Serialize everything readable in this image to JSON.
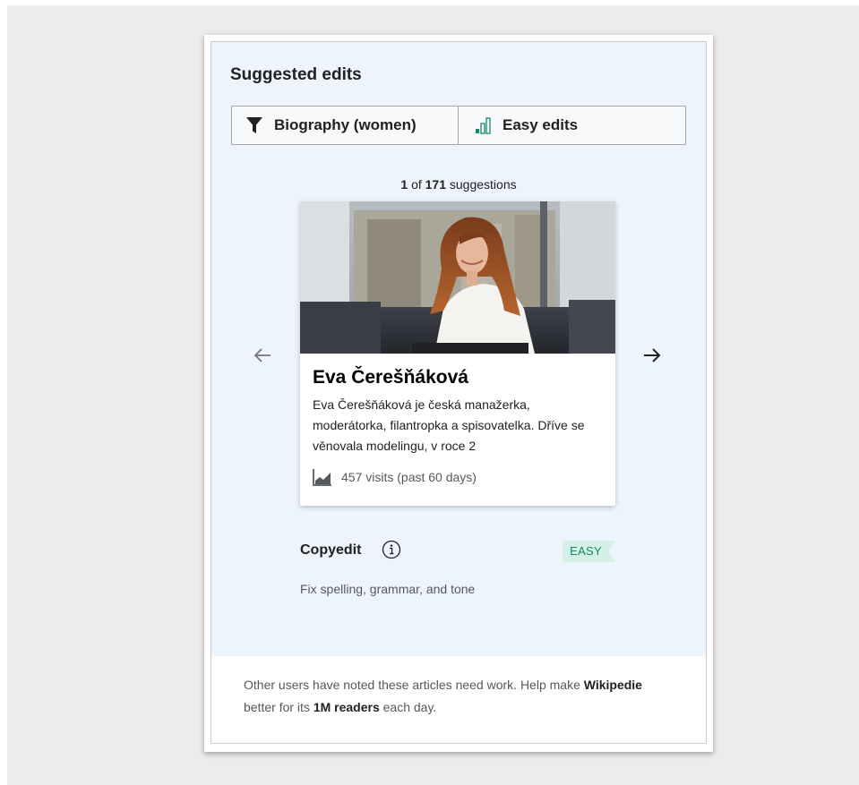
{
  "module": {
    "title": "Suggested edits"
  },
  "filters": {
    "topic_label": "Biography (women)",
    "difficulty_label": "Easy edits",
    "topic_icon": "funnel-icon",
    "difficulty_icon": "difficulty-bars-icon"
  },
  "pager": {
    "current": "1",
    "of_word": "of",
    "total": "171",
    "suffix": "suggestions"
  },
  "card": {
    "title": "Eva Čerešňáková",
    "extract": "Eva Čerešňáková je česká manažerka, moderátorka, filantropka a spisovatelka. Dříve se věnovala modelingu, v roce 2",
    "pageviews": "457 visits (past 60 days)",
    "pageviews_icon": "chart-icon"
  },
  "task": {
    "name": "Copyedit",
    "difficulty_badge": "EASY",
    "description": "Fix spelling, grammar, and tone"
  },
  "footer": {
    "part1": "Other users have noted these articles need work. Help make ",
    "site": "Wikipedie",
    "part2": " better for its ",
    "readers": "1M readers",
    "part3": " each day."
  },
  "colors": {
    "panel_bg": "#eef4fc",
    "badge_bg": "#d5f0e6",
    "badge_text": "#14866d",
    "accent_green": "#14866d"
  }
}
